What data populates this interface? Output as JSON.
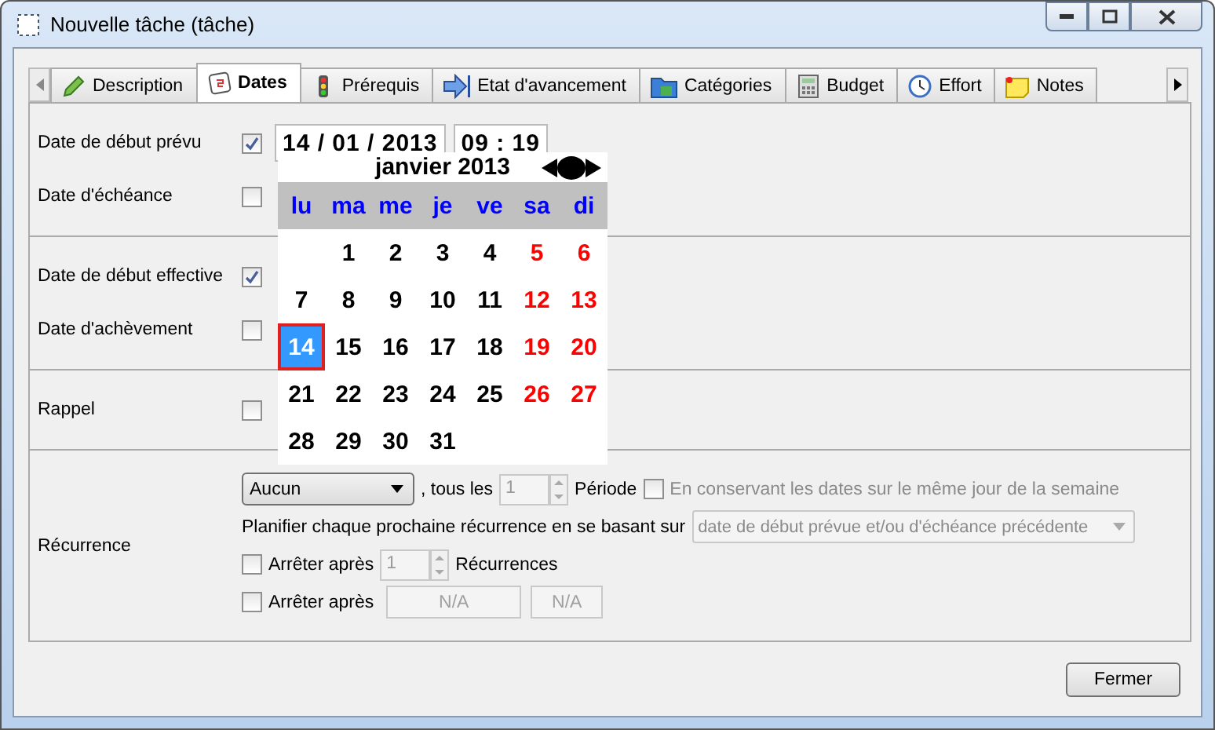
{
  "window": {
    "title": "Nouvelle tâche (tâche)"
  },
  "tabs": [
    {
      "label": "Description",
      "selected": false
    },
    {
      "label": "Dates",
      "selected": true
    },
    {
      "label": "Prérequis",
      "selected": false
    },
    {
      "label": "Etat d'avancement",
      "selected": false
    },
    {
      "label": "Catégories",
      "selected": false
    },
    {
      "label": "Budget",
      "selected": false
    },
    {
      "label": "Effort",
      "selected": false
    },
    {
      "label": "Notes",
      "selected": false
    }
  ],
  "sections": [
    {
      "rows": [
        {
          "label": "Date de début prévu",
          "checked": true,
          "date": "14 / 01 / 2013",
          "time": "09 : 19"
        },
        {
          "label": "Date d'échéance",
          "checked": false
        }
      ]
    },
    {
      "rows": [
        {
          "label": "Date de début effective",
          "checked": true
        },
        {
          "label": "Date d'achèvement",
          "checked": false
        }
      ]
    },
    {
      "rows": [
        {
          "label": "Rappel",
          "checked": false
        }
      ]
    }
  ],
  "calendar": {
    "month": "janvier 2013",
    "weekdays": [
      {
        "label": "lu"
      },
      {
        "label": "ma"
      },
      {
        "label": "me"
      },
      {
        "label": "je"
      },
      {
        "label": "ve"
      },
      {
        "label": "sa"
      },
      {
        "label": "di"
      }
    ],
    "weeks": [
      [
        {
          "kind": "blank"
        },
        {
          "day": "1",
          "kind": "weekday",
          "selected": false
        },
        {
          "day": "2",
          "kind": "weekday",
          "selected": false
        },
        {
          "day": "3",
          "kind": "weekday",
          "selected": false
        },
        {
          "day": "4",
          "kind": "weekday",
          "selected": false
        },
        {
          "day": "5",
          "kind": "weekend",
          "selected": false
        },
        {
          "day": "6",
          "kind": "weekend",
          "selected": false
        }
      ],
      [
        {
          "day": "7",
          "kind": "weekday",
          "selected": false
        },
        {
          "day": "8",
          "kind": "weekday",
          "selected": false
        },
        {
          "day": "9",
          "kind": "weekday",
          "selected": false
        },
        {
          "day": "10",
          "kind": "weekday",
          "selected": false
        },
        {
          "day": "11",
          "kind": "weekday",
          "selected": false
        },
        {
          "day": "12",
          "kind": "weekend",
          "selected": false
        },
        {
          "day": "13",
          "kind": "weekend",
          "selected": false
        }
      ],
      [
        {
          "day": "14",
          "kind": "weekday",
          "selected": true
        },
        {
          "day": "15",
          "kind": "weekday",
          "selected": false
        },
        {
          "day": "16",
          "kind": "weekday",
          "selected": false
        },
        {
          "day": "17",
          "kind": "weekday",
          "selected": false
        },
        {
          "day": "18",
          "kind": "weekday",
          "selected": false
        },
        {
          "day": "19",
          "kind": "weekend",
          "selected": false
        },
        {
          "day": "20",
          "kind": "weekend",
          "selected": false
        }
      ],
      [
        {
          "day": "21",
          "kind": "weekday",
          "selected": false
        },
        {
          "day": "22",
          "kind": "weekday",
          "selected": false
        },
        {
          "day": "23",
          "kind": "weekday",
          "selected": false
        },
        {
          "day": "24",
          "kind": "weekday",
          "selected": false
        },
        {
          "day": "25",
          "kind": "weekday",
          "selected": false
        },
        {
          "day": "26",
          "kind": "weekend",
          "selected": false
        },
        {
          "day": "27",
          "kind": "weekend",
          "selected": false
        }
      ],
      [
        {
          "day": "28",
          "kind": "weekday",
          "selected": false
        },
        {
          "day": "29",
          "kind": "weekday",
          "selected": false
        },
        {
          "day": "30",
          "kind": "weekday",
          "selected": false
        },
        {
          "day": "31",
          "kind": "weekday",
          "selected": false
        }
      ]
    ]
  },
  "recurrence": {
    "label": "Récurrence",
    "frequency": "Aucun",
    "every_text": ", tous les",
    "every_value": "1",
    "period_text": "Période",
    "same_weekday": {
      "label": "En conservant les dates sur le même jour de la semaine",
      "checked": false,
      "disabled": true
    },
    "plan_text": "Planifier chaque prochaine récurrence en se basant sur",
    "plan_value": "date de début prévue et/ou d'échéance précédente",
    "stop_count": {
      "label": "Arrêter après",
      "checked": false,
      "value": "1",
      "unit": "Récurrences"
    },
    "stop_date": {
      "label": "Arrêter après",
      "checked": false,
      "date": "N/A",
      "time": "N/A"
    }
  },
  "buttons": [
    {
      "label": "Fermer"
    }
  ]
}
